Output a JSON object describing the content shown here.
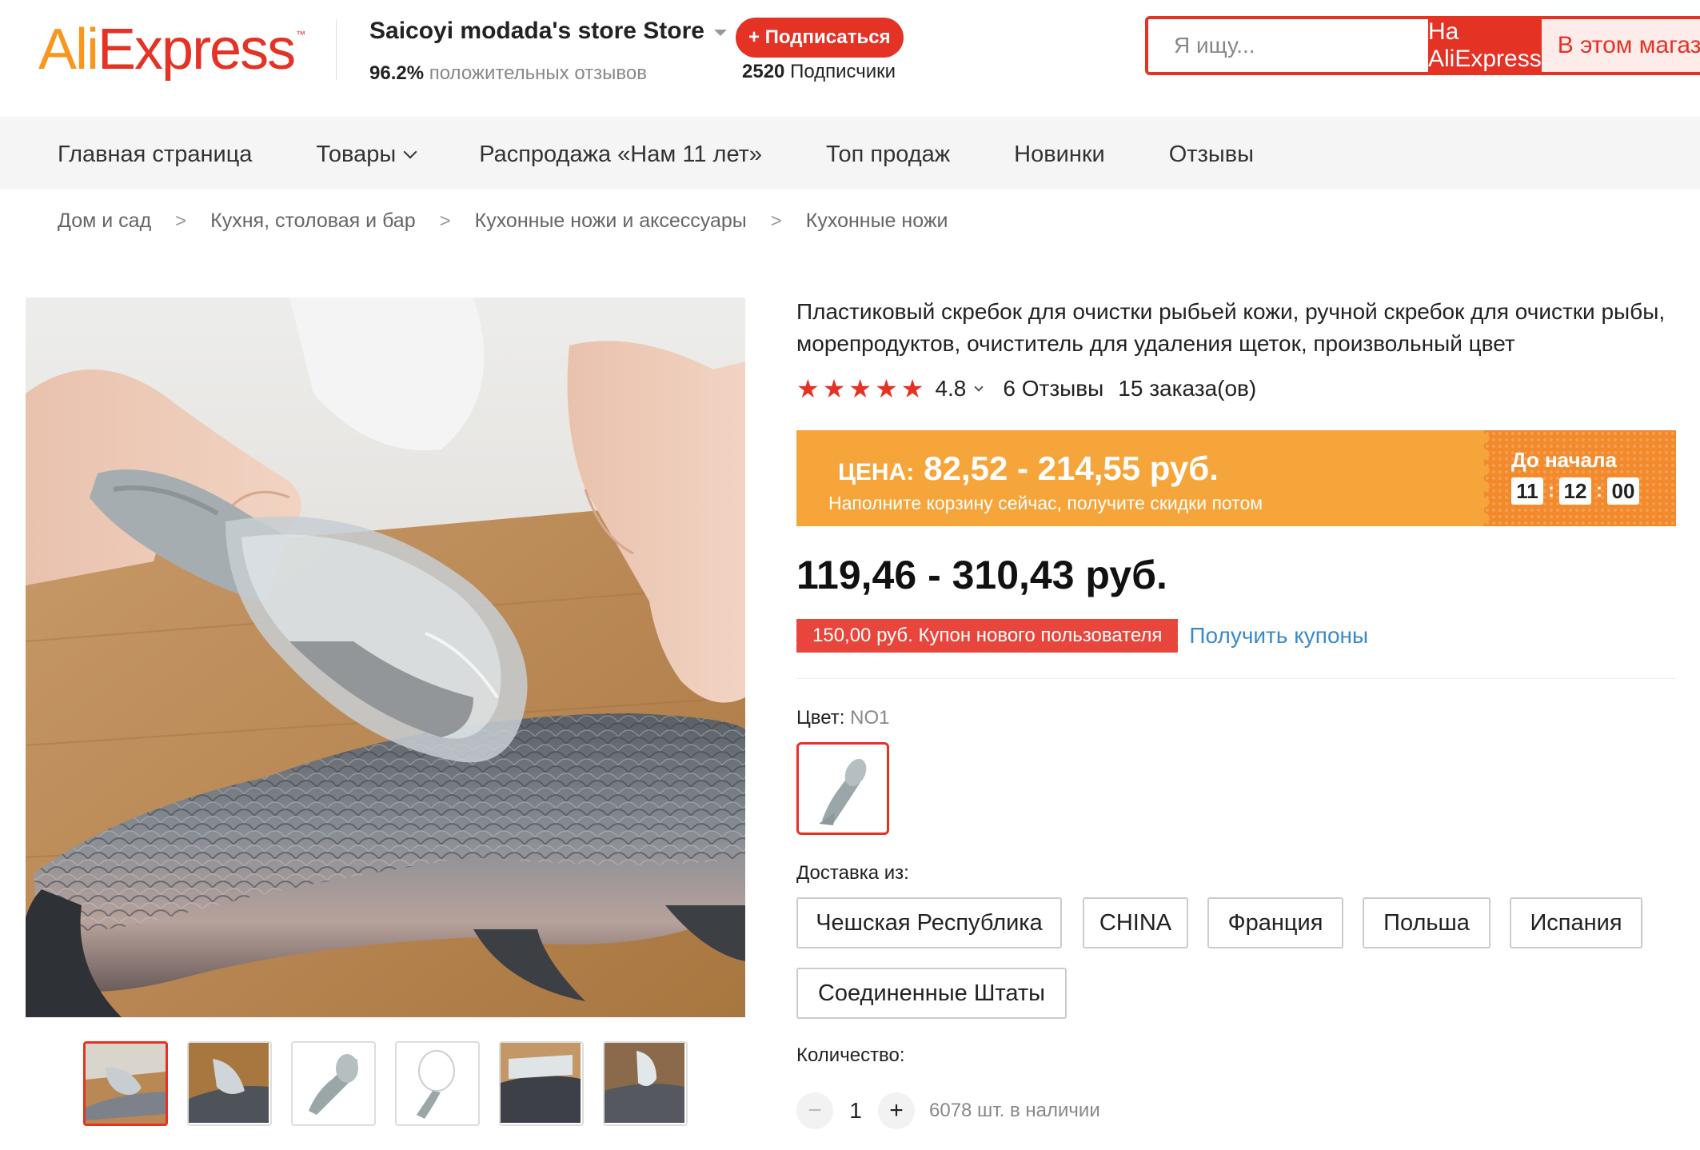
{
  "header": {
    "logo_text_ali": "Ali",
    "logo_text_express": "Express",
    "logo_tm": "™",
    "store_name": "Saicoyi modada's store Store",
    "store_rating_value": "96.2%",
    "store_rating_label": "положительных отзывов",
    "subscribe_label": "+ Подписаться",
    "subscribers_count": "2520",
    "subscribers_label": "Подписчики",
    "search_placeholder": "Я ищу...",
    "search_btn_ali": "На AliExpress",
    "search_btn_store": "В этом магазине"
  },
  "nav": {
    "items": [
      "Главная страница",
      "Товары",
      "Распродажа «Нам 11 лет»",
      "Топ продаж",
      "Новинки",
      "Отзывы"
    ]
  },
  "breadcrumb": {
    "items": [
      "Дом и сад",
      "Кухня, столовая и бар",
      "Кухонные ножи и аксессуары",
      "Кухонные ножи"
    ],
    "separator": ">"
  },
  "product": {
    "title": "Пластиковый скребок для очистки рыбьей кожи, ручной скребок для очистки рыбы, морепродуктов, очиститель для удаления щеток, произвольный цвет",
    "rating": "4.8",
    "stars": 5,
    "reviews": "6 Отзывы",
    "orders": "15 заказа(ов)",
    "promo_label": "ЦЕНА:",
    "promo_price": "82,52 - 214,55 руб.",
    "promo_sub": "Наполните корзину сейчас, получите скидки потом",
    "countdown_label": "До начала",
    "countdown": [
      "11",
      "12",
      "00"
    ],
    "price": "119,46 - 310,43 руб.",
    "coupon": "150,00 руб. Купон нового пользователя",
    "coupon_link": "Получить купоны",
    "color_label": "Цвет:",
    "color_value": "NO1",
    "ship_label": "Доставка из:",
    "ship_options": [
      "Чешская Республика",
      "CHINA",
      "Франция",
      "Польша",
      "Испания",
      "Соединенные Штаты"
    ],
    "qty_label": "Количество:",
    "qty_minus": "−",
    "qty_value": "1",
    "qty_plus": "+",
    "stock": "6078 шт. в наличии"
  },
  "colors": {
    "brand_red": "#e43225",
    "brand_orange": "#f7971e",
    "promo_bg": "#f5a53a",
    "link_blue": "#3a8ac9"
  }
}
